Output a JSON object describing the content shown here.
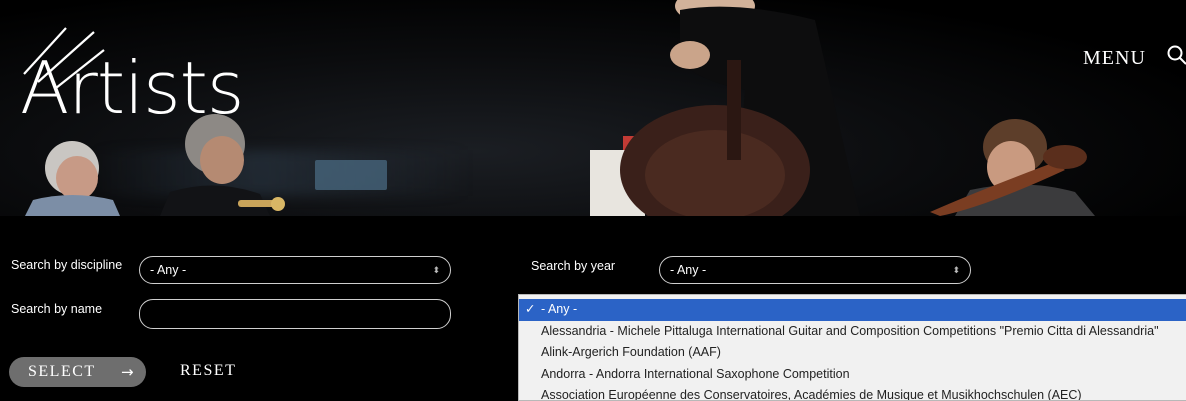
{
  "header": {
    "title": "Artists",
    "menu_label": "MENU",
    "search_icon": "search-icon"
  },
  "filters": {
    "discipline": {
      "label": "Search by discipline",
      "value": "- Any -"
    },
    "name": {
      "label": "Search by name",
      "value": ""
    },
    "year": {
      "label": "Search by year",
      "value": "- Any -"
    }
  },
  "buttons": {
    "select_label": "SELECT",
    "select_arrow": "→",
    "reset_label": "RESET"
  },
  "dropdown": {
    "check_mark": "✓",
    "options": [
      "- Any -",
      "Alessandria - Michele Pittaluga International Guitar and Composition Competitions \"Premio Citta di Alessandria\"",
      "Alink-Argerich Foundation (AAF)",
      "Andorra - Andorra International Saxophone Competition",
      "Association Européenne des Conservatoires, Académies de Musique et Musikhochschulen (AEC)"
    ]
  },
  "colors": {
    "background": "#000000",
    "select_button": "#6e6e6e",
    "dropdown_highlight": "#2b63c6",
    "dropdown_background": "#f1f1f1"
  }
}
